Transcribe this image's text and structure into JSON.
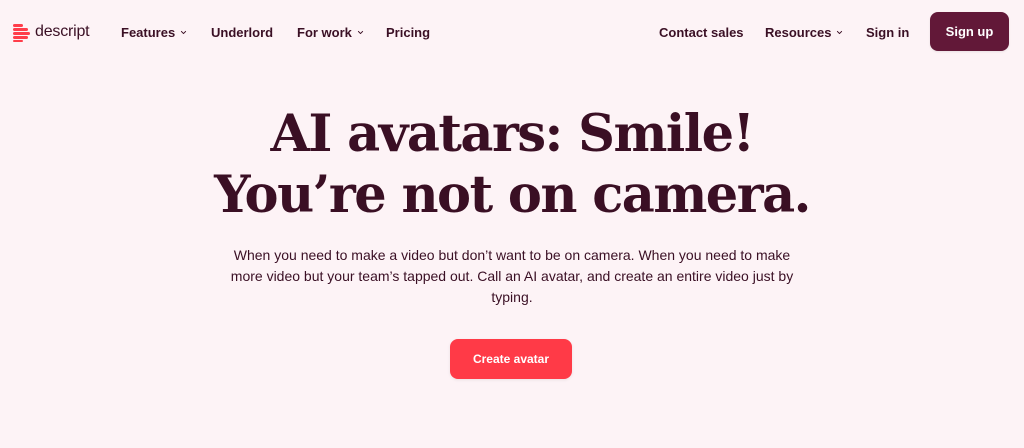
{
  "brand": {
    "name": "descript",
    "accent": "#ff3d4a",
    "text_color": "#3a0f24",
    "background": "#fdf3f6"
  },
  "nav": {
    "features": "Features",
    "underlord": "Underlord",
    "for_work": "For work",
    "pricing": "Pricing",
    "contact_sales": "Contact sales",
    "resources": "Resources",
    "sign_in": "Sign in",
    "sign_up": "Sign up",
    "sign_up_color": "#621838"
  },
  "hero": {
    "headline_line1": "AI avatars: Smile!",
    "headline_line2": "You’re not on camera.",
    "subtitle": "When you need to make a video but don’t want to be on camera. When you need to make more video but your team’s tapped out. Call an AI avatar, and create an entire video just by typing.",
    "cta": "Create avatar",
    "cta_color": "#ff3a47"
  }
}
